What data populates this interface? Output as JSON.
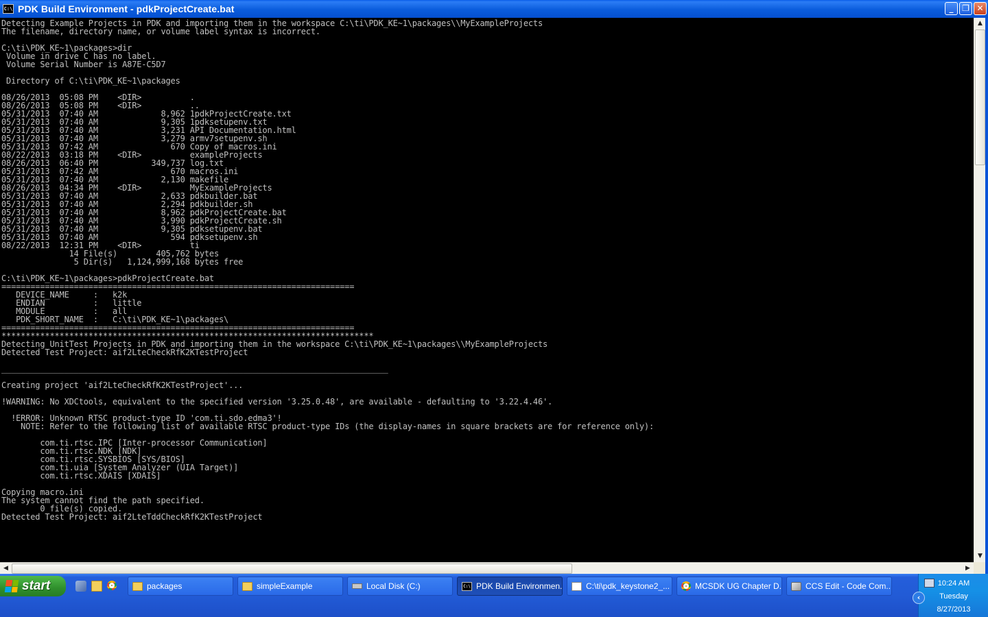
{
  "window": {
    "title": "PDK Build Environment - pdkProjectCreate.bat",
    "app_icon": "C:\\",
    "controls": {
      "minimize": "_",
      "maximize": "❐",
      "close": "✕"
    }
  },
  "console": {
    "lines": [
      "Detecting Example Projects in PDK and importing them in the workspace C:\\ti\\PDK_KE~1\\packages\\\\MyExampleProjects",
      "The filename, directory name, or volume label syntax is incorrect.",
      "",
      "C:\\ti\\PDK_KE~1\\packages>dir",
      " Volume in drive C has no label.",
      " Volume Serial Number is A87E-C5D7",
      "",
      " Directory of C:\\ti\\PDK_KE~1\\packages",
      "",
      "08/26/2013  05:08 PM    <DIR>          .",
      "08/26/2013  05:08 PM    <DIR>          ..",
      "05/31/2013  07:40 AM             8,962 1pdkProjectCreate.txt",
      "05/31/2013  07:40 AM             9,305 1pdksetupenv.txt",
      "05/31/2013  07:40 AM             3,231 API Documentation.html",
      "05/31/2013  07:40 AM             3,279 armv7setupenv.sh",
      "05/31/2013  07:42 AM               670 Copy of macros.ini",
      "08/22/2013  03:18 PM    <DIR>          exampleProjects",
      "08/26/2013  06:40 PM           349,737 log.txt",
      "05/31/2013  07:42 AM               670 macros.ini",
      "05/31/2013  07:40 AM             2,130 makefile",
      "08/26/2013  04:34 PM    <DIR>          MyExampleProjects",
      "05/31/2013  07:40 AM             2,633 pdkbuilder.bat",
      "05/31/2013  07:40 AM             2,294 pdkbuilder.sh",
      "05/31/2013  07:40 AM             8,962 pdkProjectCreate.bat",
      "05/31/2013  07:40 AM             3,990 pdkProjectCreate.sh",
      "05/31/2013  07:40 AM             9,305 pdksetupenv.bat",
      "05/31/2013  07:40 AM               594 pdksetupenv.sh",
      "08/22/2013  12:31 PM    <DIR>          ti",
      "              14 File(s)        405,762 bytes",
      "               5 Dir(s)   1,124,999,168 bytes free",
      "",
      "C:\\ti\\PDK_KE~1\\packages>pdkProjectCreate.bat",
      "=========================================================================",
      "   DEVICE_NAME     :   k2k",
      "   ENDIAN          :   little",
      "   MODULE          :   all",
      "   PDK_SHORT_NAME  :   C:\\ti\\PDK_KE~1\\packages\\",
      "=========================================================================",
      "*****************************************************************************",
      "Detecting UnitTest Projects in PDK and importing them in the workspace C:\\ti\\PDK_KE~1\\packages\\\\MyExampleProjects",
      "Detected Test Project: aif2LteCheckRfK2KTestProject",
      "",
      "________________________________________________________________________________",
      "",
      "Creating project 'aif2LteCheckRfK2KTestProject'...",
      "",
      "!WARNING: No XDCtools, equivalent to the specified version '3.25.0.48', are available - defaulting to '3.22.4.46'.",
      "",
      "  !ERROR: Unknown RTSC product-type ID 'com.ti.sdo.edma3'!",
      "    NOTE: Refer to the following list of available RTSC product-type IDs (the display-names in square brackets are for reference only):",
      "",
      "        com.ti.rtsc.IPC [Inter-processor Communication]",
      "        com.ti.rtsc.NDK [NDK]",
      "        com.ti.rtsc.SYSBIOS [SYS/BIOS]",
      "        com.ti.uia [System Analyzer (UIA Target)]",
      "        com.ti.rtsc.XDAIS [XDAIS]",
      "",
      "Copying macro.ini",
      "The system cannot find the path specified.",
      "        0 file(s) copied.",
      "Detected Test Project: aif2LteTddCheckRfK2KTestProject"
    ]
  },
  "scrollbars": {
    "up": "▲",
    "down": "▼",
    "left": "◀",
    "right": "▶"
  },
  "taskbar": {
    "start_label": "start",
    "quick_launch": [
      "virtualbox-icon",
      "folder-icon",
      "chrome-icon"
    ],
    "buttons": [
      {
        "label": "packages",
        "icon": "folder-icon"
      },
      {
        "label": "simpleExample",
        "icon": "folder-icon"
      },
      {
        "label": "Local Disk (C:)",
        "icon": "drive-icon"
      },
      {
        "label": "PDK Build Environmen...",
        "icon": "cmd-icon"
      },
      {
        "label": "C:\\ti\\pdk_keystone2_...",
        "icon": "text-file-icon"
      },
      {
        "label": "MCSDK UG Chapter D...",
        "icon": "chrome-icon"
      },
      {
        "label": "CCS Edit - Code Com...",
        "icon": "ccs-icon"
      }
    ],
    "tray": {
      "time": "10:24 AM",
      "day": "Tuesday",
      "date": "8/27/2013",
      "collapse": "‹"
    }
  }
}
